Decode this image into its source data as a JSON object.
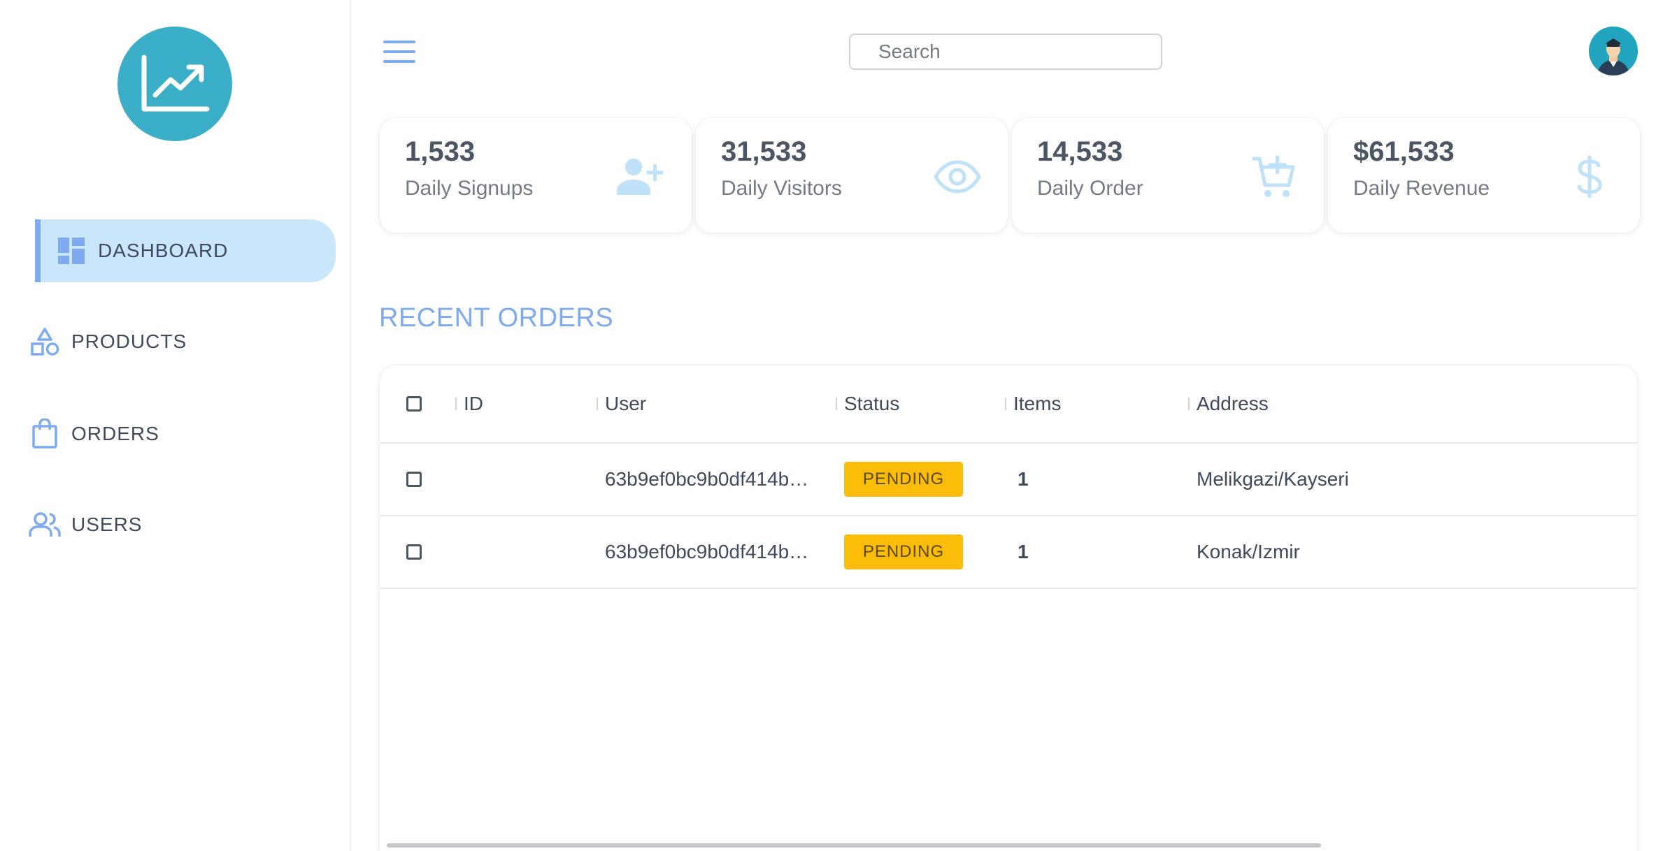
{
  "sidebar": {
    "logo_icon": "chart-trending-up-icon",
    "items": [
      {
        "label": "DASHBOARD",
        "icon": "dashboard-icon",
        "active": true
      },
      {
        "label": "PRODUCTS",
        "icon": "shapes-icon"
      },
      {
        "label": "ORDERS",
        "icon": "shopping-bag-icon"
      },
      {
        "label": "USERS",
        "icon": "users-icon"
      }
    ]
  },
  "topbar": {
    "search_placeholder": "Search",
    "menu_icon": "hamburger-icon",
    "avatar_icon": "user-avatar-icon"
  },
  "stats": [
    {
      "value": "1,533",
      "label": "Daily Signups",
      "icon": "person-add-icon"
    },
    {
      "value": "31,533",
      "label": "Daily Visitors",
      "icon": "eye-icon"
    },
    {
      "value": "14,533",
      "label": "Daily Order",
      "icon": "cart-add-icon"
    },
    {
      "value": "$61,533",
      "label": "Daily Revenue",
      "icon": "dollar-icon"
    }
  ],
  "recent_orders": {
    "title": "RECENT ORDERS",
    "columns": [
      "ID",
      "User",
      "Status",
      "Items",
      "Address"
    ],
    "rows": [
      {
        "id": "",
        "user": "63b9ef0bc9b0df414b…",
        "status": "PENDING",
        "items": "1",
        "address": "Melikgazi/Kayseri"
      },
      {
        "id": "",
        "user": "63b9ef0bc9b0df414b…",
        "status": "PENDING",
        "items": "1",
        "address": "Konak/Izmir"
      }
    ]
  },
  "colors": {
    "accent": "#7eaaf0",
    "logo_bg": "#3aaec7",
    "active_nav_bg": "#c9e6fb",
    "stat_icon": "#bfe2f8",
    "pending": "#fbbd0a"
  }
}
